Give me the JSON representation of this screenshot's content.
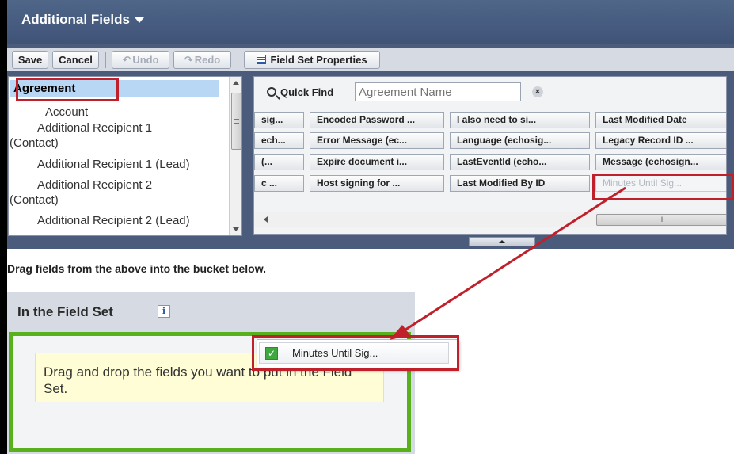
{
  "panel": {
    "title": "Additional Fields"
  },
  "toolbar": {
    "save_label": "Save",
    "cancel_label": "Cancel",
    "undo_label": "Undo",
    "redo_label": "Redo",
    "properties_label": "Field Set Properties"
  },
  "object_list": {
    "selected": "Agreement",
    "items": [
      "Account",
      "Additional Recipient 1",
      "(Contact)",
      "Additional Recipient 1 (Lead)",
      "Additional Recipient 2",
      "(Contact)",
      "Additional Recipient 2 (Lead)"
    ]
  },
  "quick_find": {
    "label": "Quick Find",
    "placeholder": "Agreement Name"
  },
  "field_grid": {
    "rows": [
      [
        "sig...",
        "Encoded Password ...",
        "I also need to si...",
        "Last Modified Date"
      ],
      [
        "ech...",
        "Error Message (ec...",
        "Language (echosig...",
        "Legacy Record ID ..."
      ],
      [
        "(...",
        "Expire document i...",
        "LastEventId (echo...",
        "Message (echosign..."
      ],
      [
        "c ...",
        "Host signing for ...",
        "Last Modified By ID",
        "Minutes Until Sig..."
      ]
    ]
  },
  "instruction": "Drag fields from the above into the bucket below.",
  "bucket": {
    "title": "In the Field Set",
    "info": "i",
    "hint": "Drag and drop the fields you want to put in the Field Set."
  },
  "drag_chip": {
    "label": "Minutes Until Sig..."
  },
  "colors": {
    "header_bg": "#4a5b7c",
    "highlight_red": "#c0202a",
    "drop_green": "#58b01c",
    "hint_yellow": "#fffdd6"
  }
}
